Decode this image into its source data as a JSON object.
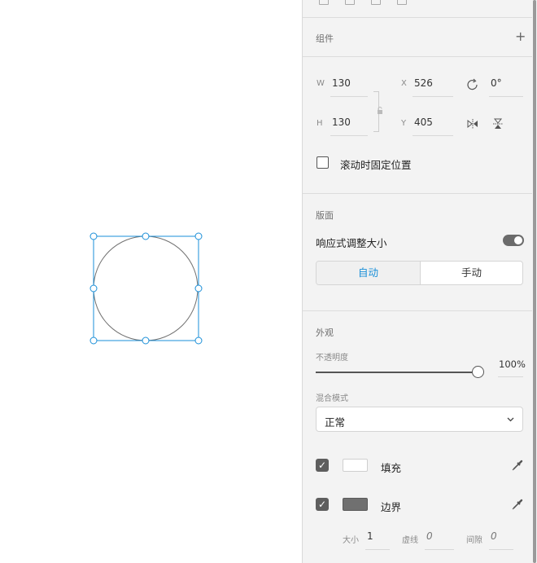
{
  "panel": {
    "components": {
      "title": "组件",
      "add_icon": "plus-icon"
    },
    "transform": {
      "w_label": "W",
      "w_value": "130",
      "x_label": "X",
      "x_value": "526",
      "rotation_value": "0°",
      "h_label": "H",
      "h_value": "130",
      "y_label": "Y",
      "y_value": "405",
      "fix_on_scroll_label": "滚动时固定位置",
      "fix_on_scroll_checked": false
    },
    "artboard": {
      "title": "版面",
      "responsive_label": "响应式调整大小",
      "responsive_on": true,
      "auto_label": "自动",
      "manual_label": "手动"
    },
    "appearance": {
      "title": "外观",
      "opacity_label": "不透明度",
      "opacity_value": "100%",
      "opacity": 1.0,
      "blend_label": "混合模式",
      "blend_value": "正常",
      "fill_label": "填充",
      "fill_checked": true,
      "fill_color": "#ffffff",
      "border_label": "边界",
      "border_checked": true,
      "border_color": "#707070",
      "size_label": "大小",
      "size_value": "1",
      "dash_label": "虚线",
      "dash_value": "0",
      "gap_label": "间隙",
      "gap_value": "0"
    }
  },
  "colors": {
    "accent": "#1a8fd8",
    "selection": "#1a8fd8"
  }
}
